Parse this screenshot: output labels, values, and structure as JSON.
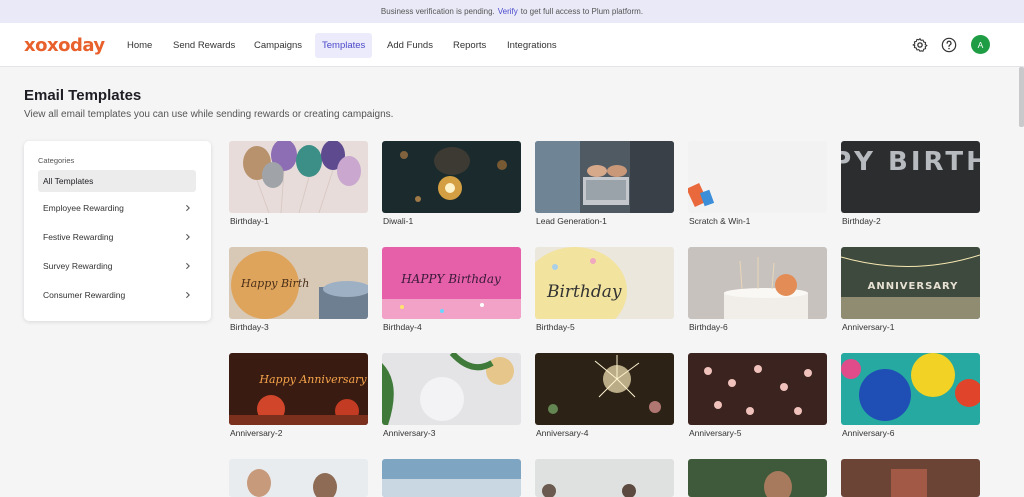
{
  "banner": {
    "before": "Business verification is pending.",
    "link": "Verify",
    "after": "to get full access to Plum platform."
  },
  "logo": "xoxoday",
  "nav": {
    "items": [
      "Home",
      "Send Rewards",
      "Campaigns",
      "Templates",
      "Add Funds",
      "Reports",
      "Integrations"
    ],
    "active": "Templates"
  },
  "icons": {
    "settings": "gear-icon",
    "help": "help-circle-icon",
    "chevron": "chevron-right-icon"
  },
  "user": {
    "avatar_initial": "A",
    "avatar_color": "#1f9d45"
  },
  "page": {
    "title": "Email Templates",
    "subtitle": "View all email templates you can use while sending rewards or creating campaigns."
  },
  "sidebar": {
    "heading": "Categories",
    "items": [
      "All Templates",
      "Employee Rewarding",
      "Festive Rewarding",
      "Survey Rewarding",
      "Consumer Rewarding"
    ]
  },
  "templates": [
    "Birthday-1",
    "Diwali-1",
    "Lead Generation-1",
    "Scratch & Win-1",
    "Birthday-2",
    "Birthday-3",
    "Birthday-4",
    "Birthday-5",
    "Birthday-6",
    "Anniversary-1",
    "Anniversary-2",
    "Anniversary-3",
    "Anniversary-4",
    "Anniversary-5",
    "Anniversary-6",
    "",
    "",
    "",
    "",
    ""
  ],
  "thumb_text": {
    "happy_birthday_balloons": "HAPPY BIRTHDAY",
    "birthday_3": "Happy Birth",
    "birthday_4": "HAPPY Birthday",
    "birthday_5": "Birthday",
    "anniversary_1": "ANNIVERSARY",
    "anniversary_2": "Happy Anniversary"
  },
  "colors": {
    "accent": "#4b48c9",
    "brand": "#e8602c"
  }
}
